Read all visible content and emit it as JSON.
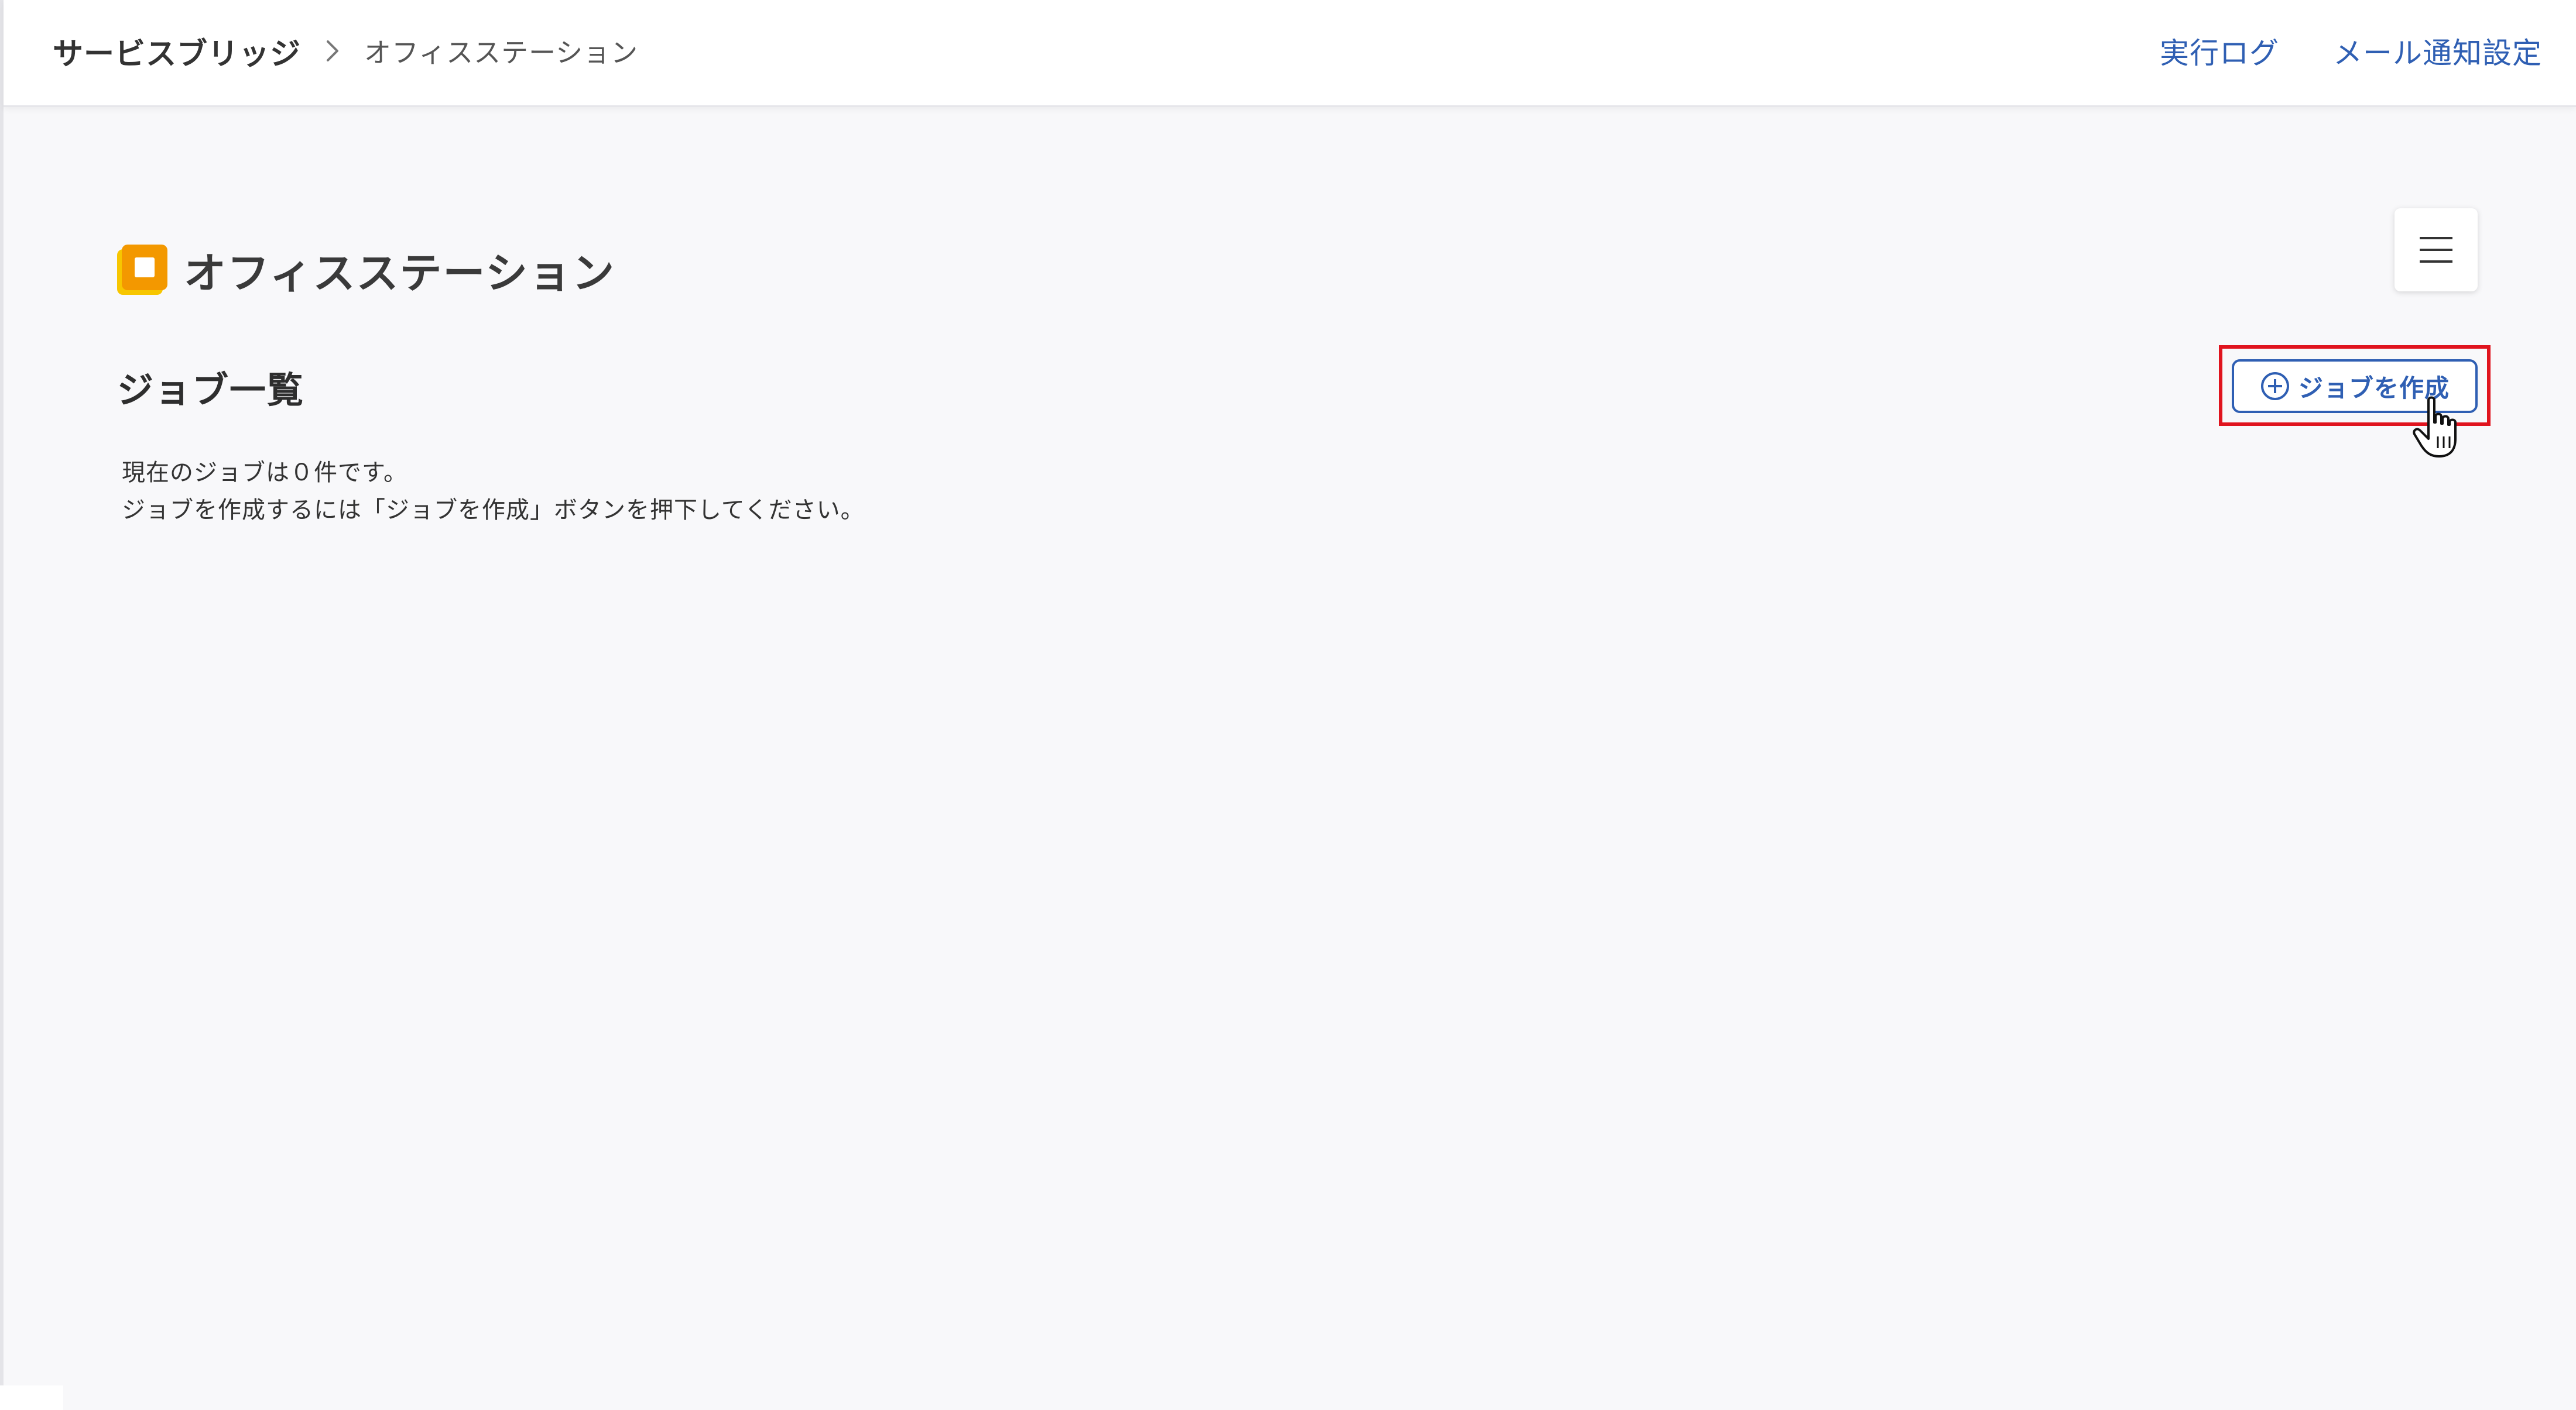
{
  "header": {
    "breadcrumb_root": "サービスブリッジ",
    "breadcrumb_current": "オフィスステーション",
    "nav": {
      "log_label": "実行ログ",
      "mail_label": "メール通知設定"
    }
  },
  "main": {
    "logo_text": "オフィスステーション",
    "page_title": "ジョブ一覧",
    "create_button_label": "ジョブを作成",
    "message_line1": "現在のジョブは０件です。",
    "message_line2": "ジョブを作成するには「ジョブを作成」ボタンを押下してください。"
  },
  "colors": {
    "link": "#2f5fb3",
    "highlight": "#e0141e",
    "logo_orange": "#f39800",
    "logo_yellow": "#f7c600"
  },
  "icons": {
    "breadcrumb_separator": "chevron-right-icon",
    "menu": "hamburger-menu-icon",
    "create": "plus-circle-icon",
    "cursor": "hand-pointer-icon",
    "logo": "office-station-logo-icon"
  }
}
